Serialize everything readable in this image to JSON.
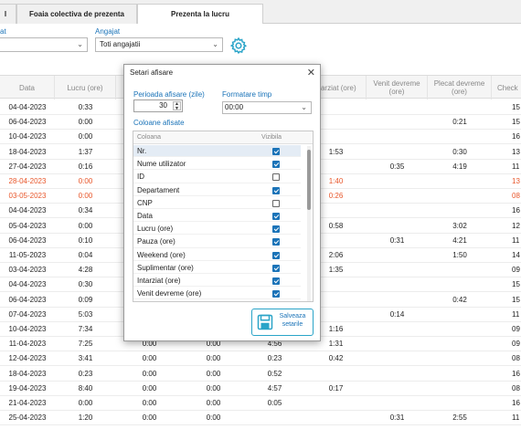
{
  "tabs": [
    {
      "label": "l"
    },
    {
      "label": "Foaia colectiva de prezenta"
    },
    {
      "label": "Prezenta la lucru"
    }
  ],
  "filters": {
    "left_label": "at",
    "employee_label": "Angajat",
    "employee_value": "Toti angajatii"
  },
  "columns": [
    "Data",
    "Lucru (ore)",
    "",
    "",
    "",
    "ntarziat (ore)",
    "Venit devreme (ore)",
    "Plecat devreme (ore)",
    "Check"
  ],
  "rows": [
    {
      "date": "04-04-2023",
      "work": "0:33",
      "c3": "",
      "c4": "",
      "c5": "",
      "late": "",
      "early_in": "",
      "early_out": "",
      "check": "15"
    },
    {
      "date": "06-04-2023",
      "work": "0:00",
      "c3": "",
      "c4": "",
      "c5": "",
      "late": "",
      "early_in": "",
      "early_out": "0:21",
      "check": "15"
    },
    {
      "date": "10-04-2023",
      "work": "0:00",
      "c3": "",
      "c4": "",
      "c5": "",
      "late": "",
      "early_in": "",
      "early_out": "",
      "check": "16"
    },
    {
      "date": "18-04-2023",
      "work": "1:37",
      "c3": "",
      "c4": "",
      "c5": "",
      "late": "1:53",
      "early_in": "",
      "early_out": "0:30",
      "check": "13"
    },
    {
      "date": "27-04-2023",
      "work": "0:16",
      "c3": "",
      "c4": "",
      "c5": "",
      "late": "",
      "early_in": "0:35",
      "early_out": "4:19",
      "check": "11"
    },
    {
      "date": "28-04-2023",
      "work": "0:00",
      "c3": "",
      "c4": "",
      "c5": "",
      "late": "1:40",
      "early_in": "",
      "early_out": "",
      "check": "13",
      "red": true
    },
    {
      "date": "03-05-2023",
      "work": "0:00",
      "c3": "",
      "c4": "",
      "c5": "",
      "late": "0:26",
      "early_in": "",
      "early_out": "",
      "check": "08",
      "red": true
    },
    {
      "date": "04-04-2023",
      "work": "0:34",
      "c3": "",
      "c4": "",
      "c5": "",
      "late": "",
      "early_in": "",
      "early_out": "",
      "check": "16"
    },
    {
      "date": "05-04-2023",
      "work": "0:00",
      "c3": "",
      "c4": "",
      "c5": "",
      "late": "0:58",
      "early_in": "",
      "early_out": "3:02",
      "check": "12"
    },
    {
      "date": "06-04-2023",
      "work": "0:10",
      "c3": "",
      "c4": "",
      "c5": "",
      "late": "",
      "early_in": "0:31",
      "early_out": "4:21",
      "check": "11"
    },
    {
      "date": "11-05-2023",
      "work": "0:04",
      "c3": "",
      "c4": "",
      "c5": "",
      "late": "2:06",
      "early_in": "",
      "early_out": "1:50",
      "check": "14"
    },
    {
      "date": "03-04-2023",
      "work": "4:28",
      "c3": "",
      "c4": "",
      "c5": "",
      "late": "1:35",
      "early_in": "",
      "early_out": "",
      "check": "09"
    },
    {
      "date": "04-04-2023",
      "work": "0:30",
      "c3": "",
      "c4": "",
      "c5": "",
      "late": "",
      "early_in": "",
      "early_out": "",
      "check": "15"
    },
    {
      "date": "06-04-2023",
      "work": "0:09",
      "c3": "",
      "c4": "",
      "c5": "",
      "late": "",
      "early_in": "",
      "early_out": "0:42",
      "check": "15"
    },
    {
      "date": "07-04-2023",
      "work": "5:03",
      "c3": "",
      "c4": "",
      "c5": "",
      "late": "",
      "early_in": "0:14",
      "early_out": "",
      "check": "11"
    },
    {
      "date": "10-04-2023",
      "work": "7:34",
      "c3": "",
      "c4": "",
      "c5": "",
      "late": "1:16",
      "early_in": "",
      "early_out": "",
      "check": "09"
    },
    {
      "date": "11-04-2023",
      "work": "7:25",
      "c3": "0:00",
      "c4": "0:00",
      "c5": "4:56",
      "late": "1:31",
      "early_in": "",
      "early_out": "",
      "check": "09"
    },
    {
      "date": "12-04-2023",
      "work": "3:41",
      "c3": "0:00",
      "c4": "0:00",
      "c5": "0:23",
      "late": "0:42",
      "early_in": "",
      "early_out": "",
      "check": "08"
    },
    {
      "date": "18-04-2023",
      "work": "0:23",
      "c3": "0:00",
      "c4": "0:00",
      "c5": "0:52",
      "late": "",
      "early_in": "",
      "early_out": "",
      "check": "16"
    },
    {
      "date": "19-04-2023",
      "work": "8:40",
      "c3": "0:00",
      "c4": "0:00",
      "c5": "4:57",
      "late": "0:17",
      "early_in": "",
      "early_out": "",
      "check": "08"
    },
    {
      "date": "21-04-2023",
      "work": "0:00",
      "c3": "0:00",
      "c4": "0:00",
      "c5": "0:05",
      "late": "",
      "early_in": "",
      "early_out": "",
      "check": "16"
    },
    {
      "date": "25-04-2023",
      "work": "1:20",
      "c3": "0:00",
      "c4": "0:00",
      "c5": "",
      "late": "",
      "early_in": "0:31",
      "early_out": "2:55",
      "check": "11"
    }
  ],
  "modal": {
    "title": "Setari afisare",
    "close": "✕",
    "period_label": "Perioada afisare (zile)",
    "period_value": "30",
    "time_format_label": "Formatare timp",
    "time_format_value": "00:00",
    "columns_label": "Coloane afisate",
    "col_header_name": "Coloana",
    "col_header_visible": "Vizibila",
    "columns": [
      {
        "name": "Nr.",
        "visible": true
      },
      {
        "name": "Nume utilizator",
        "visible": true
      },
      {
        "name": "ID",
        "visible": false
      },
      {
        "name": "Departament",
        "visible": true
      },
      {
        "name": "CNP",
        "visible": false
      },
      {
        "name": "Data",
        "visible": true
      },
      {
        "name": "Lucru (ore)",
        "visible": true
      },
      {
        "name": "Pauza (ore)",
        "visible": true
      },
      {
        "name": "Weekend (ore)",
        "visible": true
      },
      {
        "name": "Suplimentar (ore)",
        "visible": true
      },
      {
        "name": "Intarziat (ore)",
        "visible": true
      },
      {
        "name": "Venit devreme (ore)",
        "visible": true
      }
    ],
    "save_label_1": "Salveaza",
    "save_label_2": "setarile"
  },
  "colors": {
    "accent": "#1a73b8",
    "warning": "#e8562a",
    "save_icon": "#2aa4c8"
  }
}
